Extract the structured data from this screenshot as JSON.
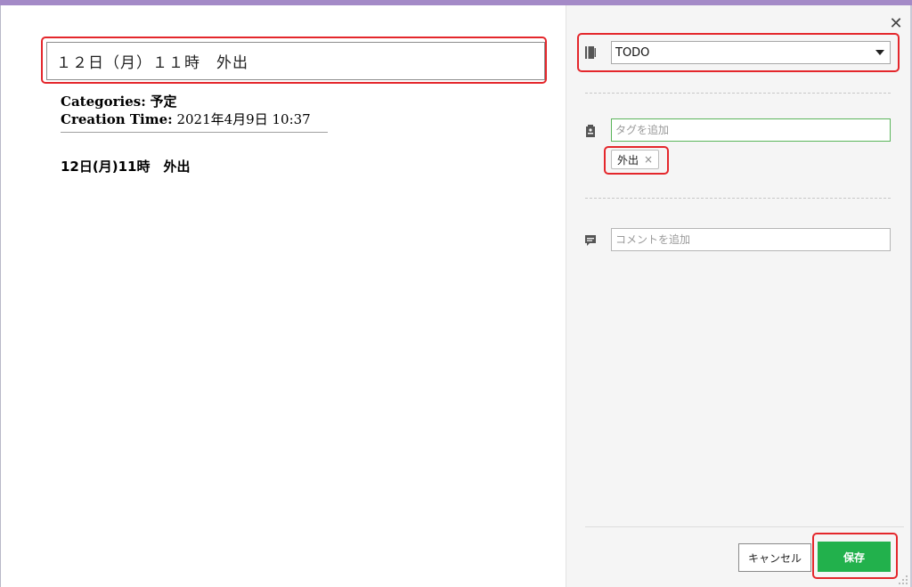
{
  "note": {
    "title": "１２日（月）１１時　外出",
    "categories_label": "Categories:",
    "categories_value": "予定",
    "creation_label": "Creation Time:",
    "creation_value": "2021年4月9日 10:37",
    "body": "12日(月)11時　外出"
  },
  "panel": {
    "notebook_value": "TODO",
    "tag_placeholder": "タグを追加",
    "tags": [
      {
        "label": "外出",
        "remove": "×"
      }
    ],
    "comment_placeholder": "コメントを追加",
    "cancel_label": "キャンセル",
    "save_label": "保存",
    "close_glyph": "✕"
  },
  "icons": {
    "notebook": "notebook-icon",
    "tag": "tag-icon",
    "comment": "comment-icon",
    "close": "close-icon"
  },
  "colors": {
    "accent_green": "#22b14c",
    "highlight_red": "#e4272c",
    "top_bar": "#a48ac7"
  }
}
